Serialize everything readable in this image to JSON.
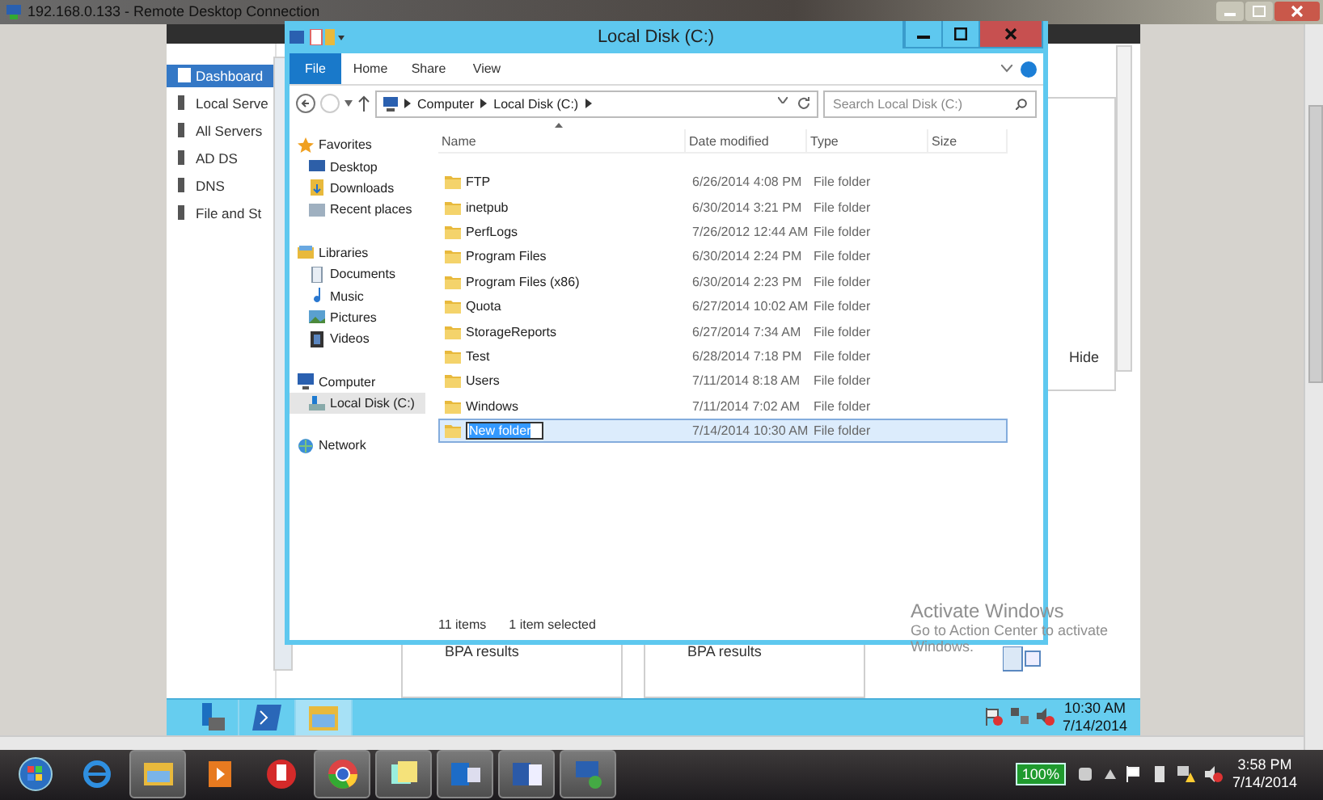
{
  "rdp": {
    "title": "192.168.0.133 - Remote Desktop Connection"
  },
  "server_manager": {
    "nav": [
      {
        "label": "Dashboard",
        "selected": true
      },
      {
        "label": "Local Serve",
        "selected": false
      },
      {
        "label": "All Servers",
        "selected": false
      },
      {
        "label": "AD DS",
        "selected": false
      },
      {
        "label": "DNS",
        "selected": false
      },
      {
        "label": "File and St",
        "selected": false
      }
    ],
    "hide": "Hide",
    "tiles": [
      "BPA results",
      "BPA results"
    ]
  },
  "explorer": {
    "title": "Local Disk (C:)",
    "ribbon_tabs": [
      {
        "label": "File",
        "selected": true
      },
      {
        "label": "Home",
        "selected": false
      },
      {
        "label": "Share",
        "selected": false
      },
      {
        "label": "View",
        "selected": false
      }
    ],
    "path": [
      "Computer",
      "Local Disk (C:)"
    ],
    "search": {
      "placeholder": "Search Local Disk (C:)"
    },
    "nav": [
      {
        "label": "Favorites",
        "kind": "favorites",
        "selected": false,
        "children": [
          {
            "label": "Desktop",
            "kind": "desktop",
            "selected": false
          },
          {
            "label": "Downloads",
            "kind": "downloads",
            "selected": false
          },
          {
            "label": "Recent places",
            "kind": "recent",
            "selected": false
          }
        ]
      },
      {
        "label": "Libraries",
        "kind": "libraries",
        "selected": false,
        "children": [
          {
            "label": "Documents",
            "kind": "documents",
            "selected": false
          },
          {
            "label": "Music",
            "kind": "music",
            "selected": false
          },
          {
            "label": "Pictures",
            "kind": "pictures",
            "selected": false
          },
          {
            "label": "Videos",
            "kind": "videos",
            "selected": false
          }
        ]
      },
      {
        "label": "Computer",
        "kind": "computer",
        "selected": false,
        "children": [
          {
            "label": "Local Disk (C:)",
            "kind": "disk",
            "selected": true
          }
        ]
      },
      {
        "label": "Network",
        "kind": "network",
        "selected": false
      }
    ],
    "columns": [
      "Name",
      "Date modified",
      "Type",
      "Size"
    ],
    "rows": [
      {
        "name": "FTP",
        "date": "6/26/2014 4:08 PM",
        "type": "File folder",
        "selected": false,
        "editing": false
      },
      {
        "name": "inetpub",
        "date": "6/30/2014 3:21 PM",
        "type": "File folder",
        "selected": false,
        "editing": false
      },
      {
        "name": "PerfLogs",
        "date": "7/26/2012 12:44 AM",
        "type": "File folder",
        "selected": false,
        "editing": false
      },
      {
        "name": "Program Files",
        "date": "6/30/2014 2:24 PM",
        "type": "File folder",
        "selected": false,
        "editing": false
      },
      {
        "name": "Program Files (x86)",
        "date": "6/30/2014 2:23 PM",
        "type": "File folder",
        "selected": false,
        "editing": false
      },
      {
        "name": "Quota",
        "date": "6/27/2014 10:02 AM",
        "type": "File folder",
        "selected": false,
        "editing": false
      },
      {
        "name": "StorageReports",
        "date": "6/27/2014 7:34 AM",
        "type": "File folder",
        "selected": false,
        "editing": false
      },
      {
        "name": "Test",
        "date": "6/28/2014 7:18 PM",
        "type": "File folder",
        "selected": false,
        "editing": false
      },
      {
        "name": "Users",
        "date": "7/11/2014 8:18 AM",
        "type": "File folder",
        "selected": false,
        "editing": false
      },
      {
        "name": "Windows",
        "date": "7/11/2014 7:02 AM",
        "type": "File folder",
        "selected": false,
        "editing": false
      },
      {
        "name": "New folder",
        "date": "7/14/2014 10:30 AM",
        "type": "File folder",
        "selected": true,
        "editing": true
      }
    ],
    "status": [
      "11 items",
      "1 item selected"
    ]
  },
  "activation": {
    "title": "Activate Windows",
    "message": "Go to Action Center to activate Windows."
  },
  "remote_taskbar": {
    "time": "10:30 AM",
    "date": "7/14/2014"
  },
  "taskbar": {
    "battery": "100%",
    "time": "3:58 PM",
    "date": "7/14/2014"
  }
}
